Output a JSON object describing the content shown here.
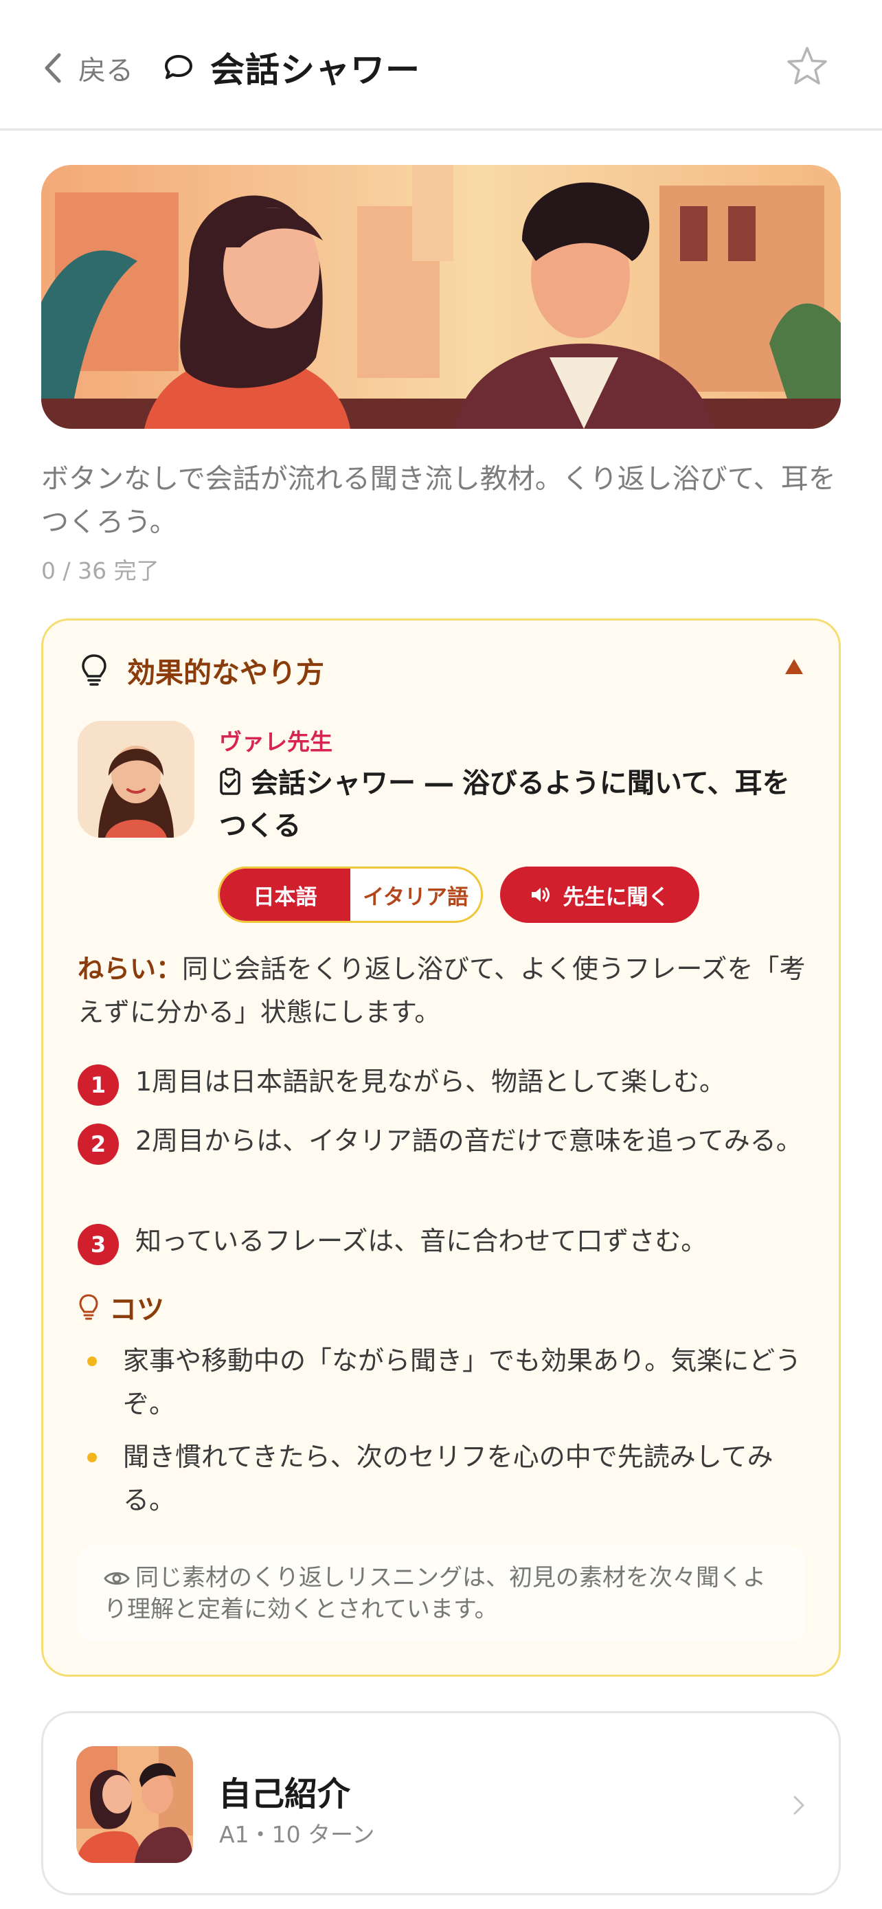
{
  "header": {
    "back_label": "戻る",
    "title": "会話シャワー"
  },
  "description": "ボタンなしで会話が流れる聞き流し教材。くり返し浴びて、耳をつくろう。",
  "progress": "0 / 36 完了",
  "tips": {
    "title": "効果的なやり方",
    "teacher_name": "ヴァレ先生",
    "lesson_title": "会話シャワー ― 浴びるように聞いて、耳をつくる",
    "lang_options": [
      "日本語",
      "イタリア語"
    ],
    "ask_button": "先生に聞く",
    "goal_label": "ねらい：",
    "goal_text": "同じ会話をくり返し浴びて、よく使うフレーズを「考えずに分かる」状態にします。",
    "steps": [
      {
        "num": "1",
        "text": "1周目は日本語訳を見ながら、物語として楽しむ。"
      },
      {
        "num": "2",
        "text": "2周目からは、イタリア語の音だけで意味を追ってみる。"
      },
      {
        "num": "3",
        "text": "知っているフレーズは、音に合わせて口ずさむ。"
      }
    ],
    "kotsu_title": "コツ",
    "kotsu_items": [
      "家事や移動中の「ながら聞き」でも効果あり。気楽にどうぞ。",
      "聞き慣れてきたら、次のセリフを心の中で先読みしてみる。"
    ],
    "note": "同じ素材のくり返しリスニングは、初見の素材を次々聞くより理解と定着に効くとされています。"
  },
  "lesson": {
    "name": "自己紹介",
    "meta": "A1・10 ターン"
  },
  "colors": {
    "accent_red": "#d21f2d",
    "brown": "#8a3c0a",
    "card_bg": "#fffbf0",
    "card_border": "#f5dd72",
    "bullet_yellow": "#f2b51b"
  },
  "icons": {
    "back": "chevron-left-icon",
    "chat": "speech-bubble-icon",
    "favorite": "star-icon",
    "tips": "lightbulb-icon",
    "collapse": "triangle-up-icon",
    "lesson": "clipboard-icon",
    "speaker": "speaker-icon",
    "note": "eye-icon",
    "next": "chevron-right-icon"
  }
}
